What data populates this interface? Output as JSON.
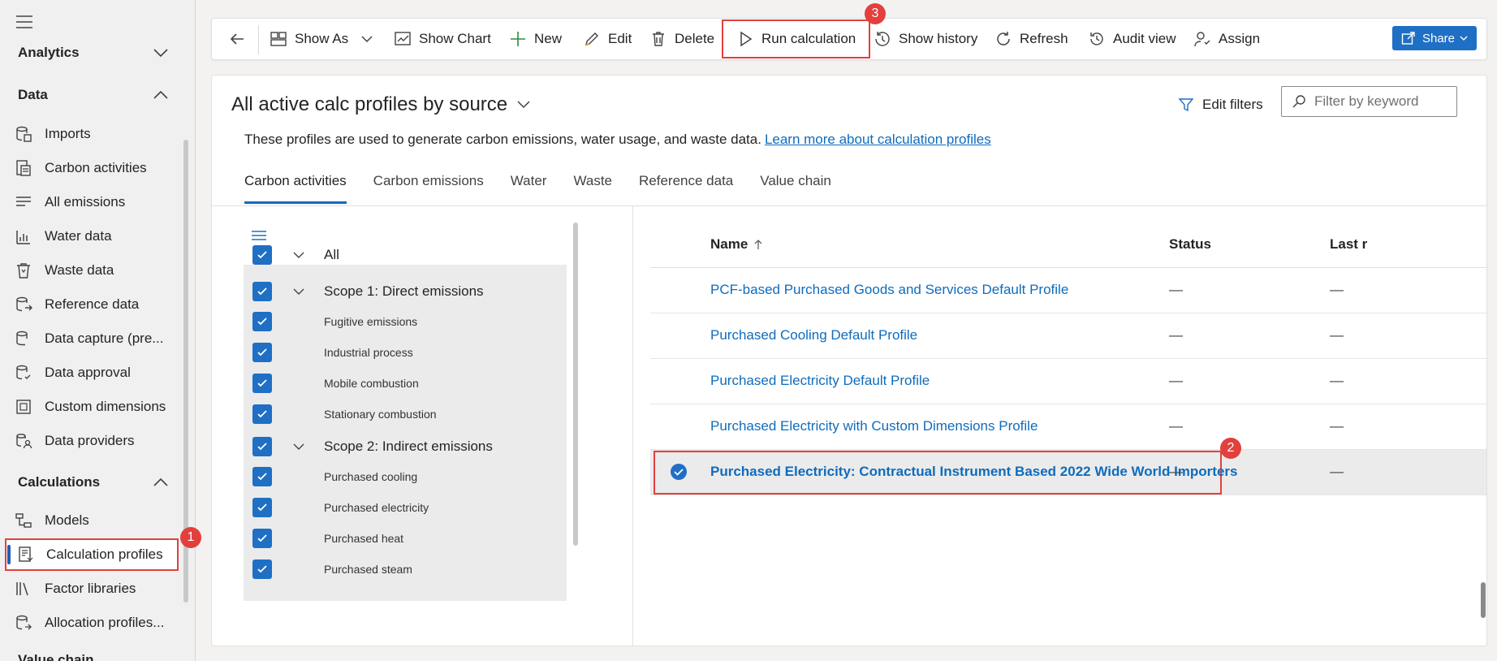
{
  "sidebar": {
    "sections": [
      {
        "title": "Analytics"
      },
      {
        "title": "Data"
      },
      {
        "title": "Calculations"
      },
      {
        "title": "Value chain"
      }
    ],
    "data_items": [
      {
        "label": "Imports",
        "icon": "imports-icon"
      },
      {
        "label": "Carbon activities",
        "icon": "carbon-activities-icon"
      },
      {
        "label": "All emissions",
        "icon": "list-icon"
      },
      {
        "label": "Water data",
        "icon": "water-data-icon"
      },
      {
        "label": "Waste data",
        "icon": "waste-bin-icon"
      },
      {
        "label": "Reference data",
        "icon": "reference-data-icon"
      },
      {
        "label": "Data capture (pre...",
        "icon": "data-capture-icon"
      },
      {
        "label": "Data approval",
        "icon": "data-approval-icon"
      },
      {
        "label": "Custom dimensions",
        "icon": "custom-dimensions-icon"
      },
      {
        "label": "Data providers",
        "icon": "data-providers-icon"
      }
    ],
    "calc_items": [
      {
        "label": "Models",
        "icon": "models-icon"
      },
      {
        "label": "Calculation profiles",
        "icon": "calculation-profiles-icon",
        "selected": true
      },
      {
        "label": "Factor libraries",
        "icon": "factor-libraries-icon"
      },
      {
        "label": "Allocation profiles...",
        "icon": "allocation-profiles-icon"
      }
    ]
  },
  "badges": [
    "1",
    "2",
    "3"
  ],
  "toolbar": {
    "show_as": "Show As",
    "show_chart": "Show Chart",
    "new": "New",
    "edit": "Edit",
    "delete": "Delete",
    "run_calculation": "Run calculation",
    "show_history": "Show history",
    "refresh": "Refresh",
    "audit_view": "Audit view",
    "assign": "Assign",
    "share": "Share"
  },
  "view": {
    "title": "All active calc profiles by source",
    "edit_filters": "Edit filters",
    "filter_placeholder": "Filter by keyword",
    "description": "These profiles are used to generate carbon emissions, water usage, and waste data.",
    "learn_more": "Learn more about calculation profiles"
  },
  "tabs": [
    "Carbon activities",
    "Carbon emissions",
    "Water",
    "Waste",
    "Reference data",
    "Value chain"
  ],
  "active_tab": "Carbon activities",
  "tree": {
    "all": "All",
    "scope1": "Scope 1: Direct emissions",
    "scope1_items": [
      "Fugitive emissions",
      "Industrial process",
      "Mobile combustion",
      "Stationary combustion"
    ],
    "scope2": "Scope 2: Indirect emissions",
    "scope2_items": [
      "Purchased cooling",
      "Purchased electricity",
      "Purchased heat",
      "Purchased steam"
    ]
  },
  "grid": {
    "columns": [
      "Name",
      "Status",
      "Last r"
    ],
    "rows": [
      {
        "name": "PCF-based Purchased Goods and Services Default Profile",
        "status": "—",
        "last": "—"
      },
      {
        "name": "Purchased Cooling Default Profile",
        "status": "—",
        "last": "—"
      },
      {
        "name": "Purchased Electricity Default Profile",
        "status": "—",
        "last": "—"
      },
      {
        "name": "Purchased Electricity with Custom Dimensions Profile",
        "status": "—",
        "last": "—"
      },
      {
        "name": "Purchased Electricity: Contractual Instrument Based 2022 Wide World Importers",
        "status": "—",
        "last": "—",
        "selected": true
      }
    ]
  },
  "colors": {
    "accent": "#0f6cbd",
    "checkbox": "#1f6fc5",
    "highlight": "#e2403c"
  }
}
